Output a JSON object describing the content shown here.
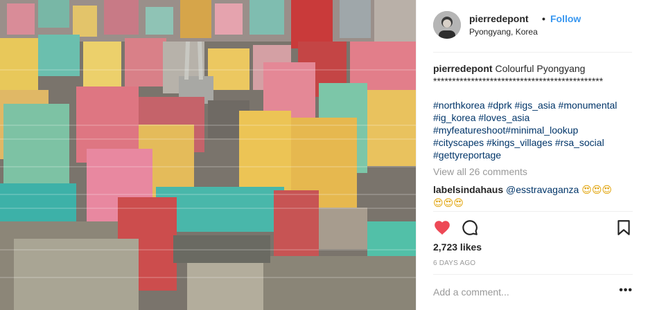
{
  "post": {
    "username": "pierredepont",
    "separator": "•",
    "follow_label": "Follow",
    "location": "Pyongyang, Korea",
    "photo_icon": "city-photo"
  },
  "caption": {
    "username": "pierredepont",
    "text": "Colourful Pyongyang",
    "stars": "*********************************************",
    "hashtags": [
      "#northkorea #dprk #igs_asia #monumental",
      "#ig_korea #loves_asia",
      "#myfeatureshoot#minimal_lookup",
      "#cityscapes #kings_villages #rsa_social",
      "#gettyreportage"
    ],
    "view_all": "View all 26 comments"
  },
  "comment": {
    "username": "labelsindahaus",
    "mention": "@esstravaganza",
    "emojis_line1": "😍😍😍",
    "emojis_line2": "😍😍😍"
  },
  "actions": {
    "like_icon": "heart-filled-icon",
    "comment_icon": "comment-icon",
    "save_icon": "bookmark-icon",
    "likes": "2,723 likes",
    "timestamp": "6 DAYS AGO"
  },
  "add_comment": {
    "placeholder": "Add a comment...",
    "more_label": "•••"
  },
  "colors": {
    "link": "#3897f0",
    "hashtag": "#003569",
    "heart": "#ed4956"
  }
}
